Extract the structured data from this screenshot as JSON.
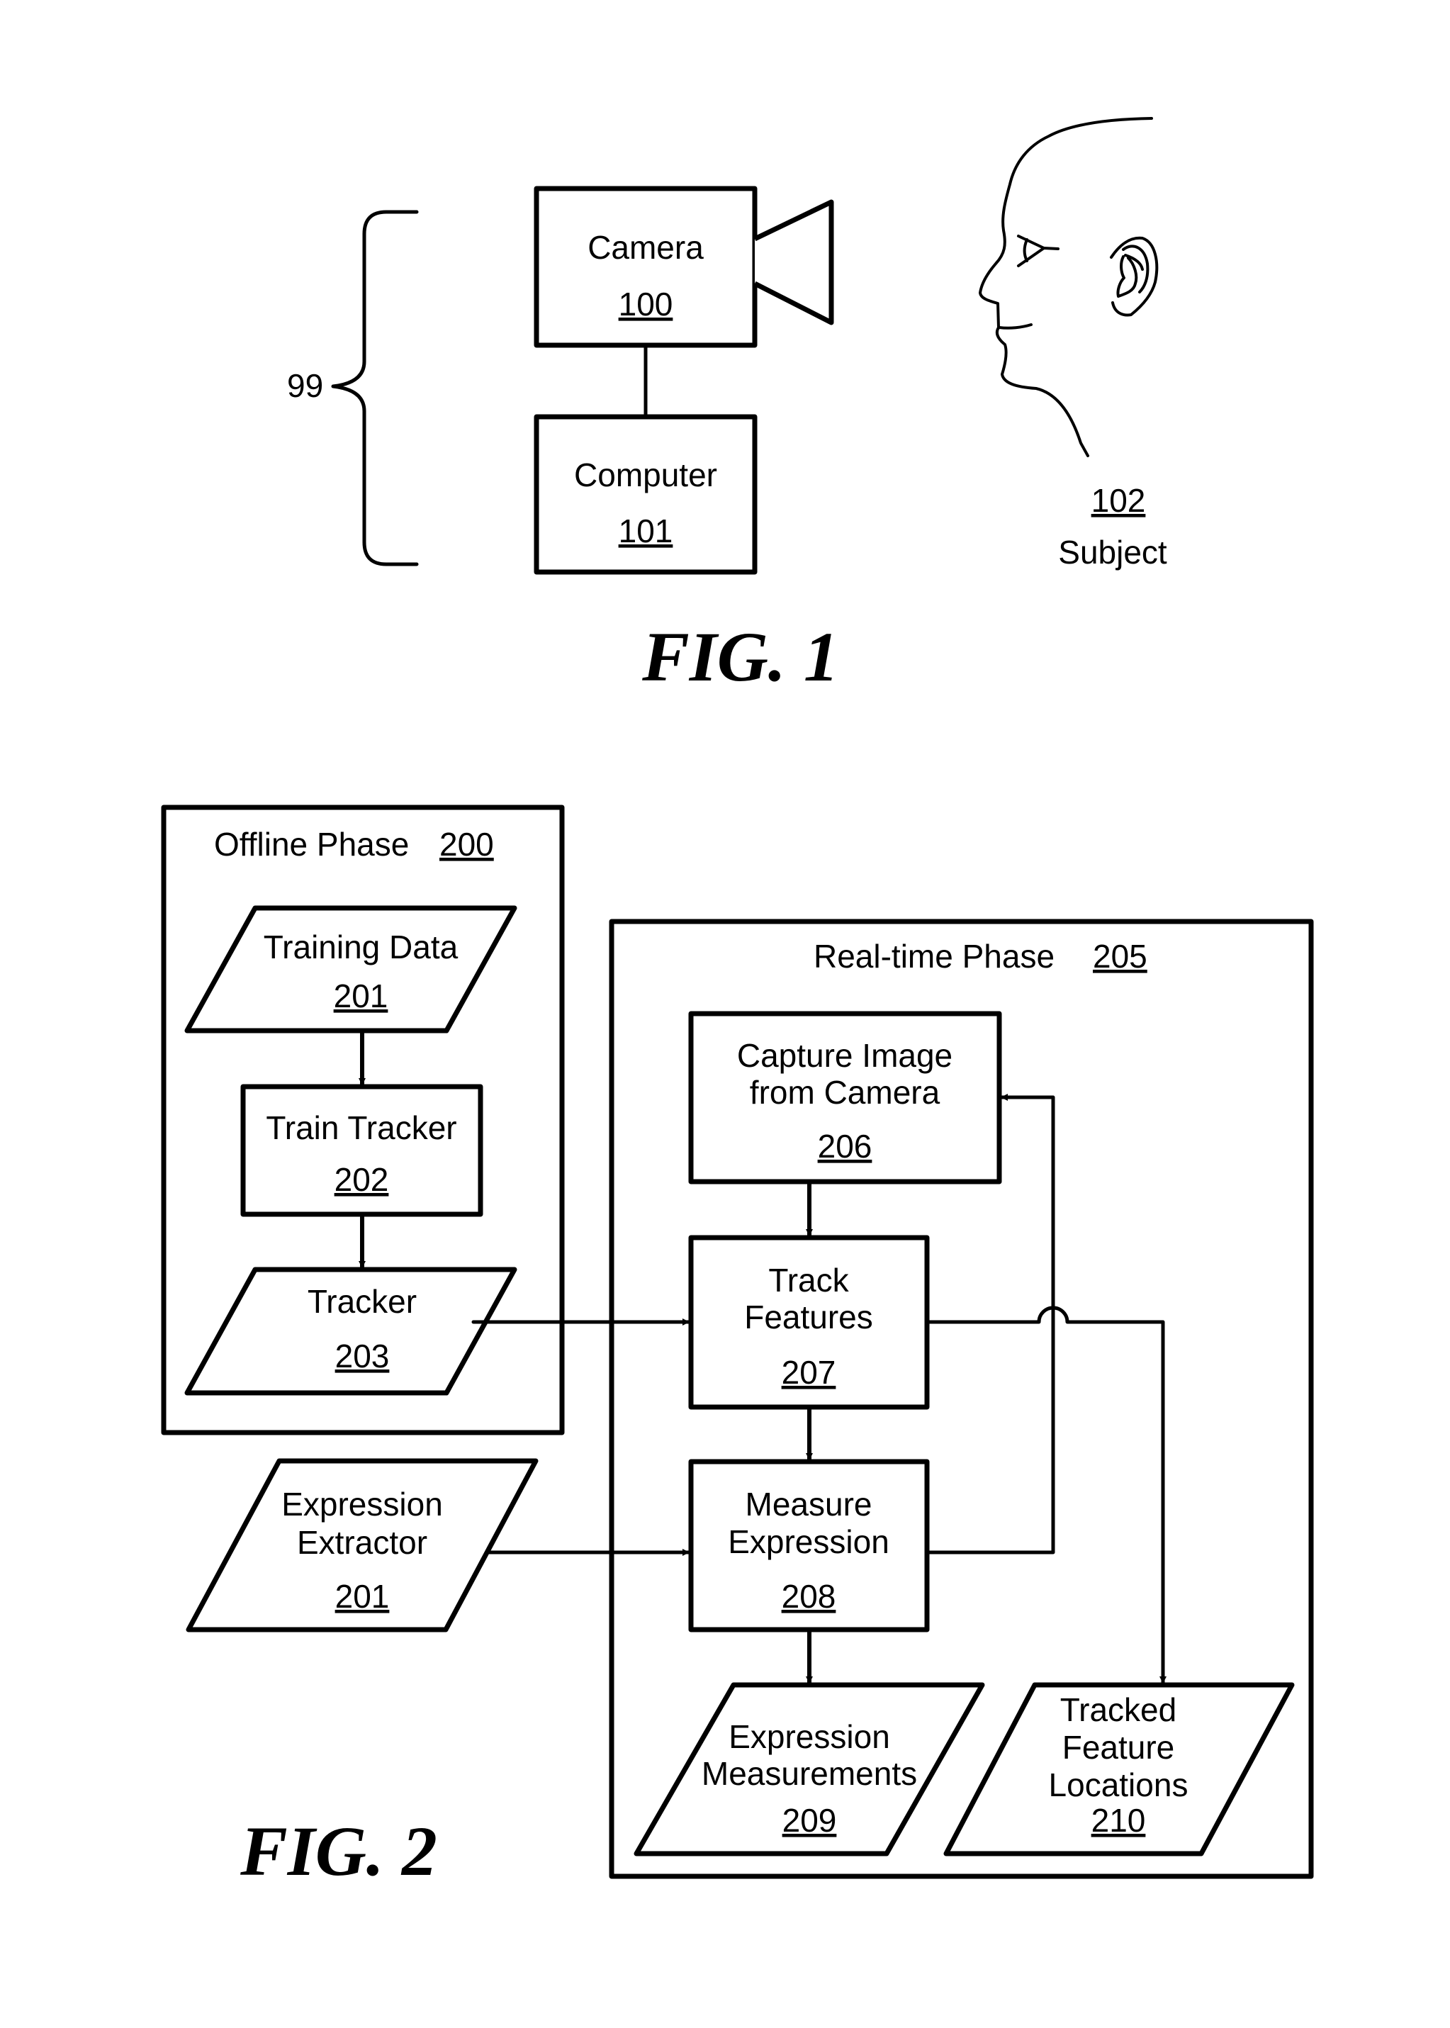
{
  "fig1": {
    "title": "FIG. 1",
    "system_label": "99",
    "camera": {
      "label": "Camera",
      "ref": "100"
    },
    "computer": {
      "label": "Computer",
      "ref": "101"
    },
    "subject": {
      "ref": "102",
      "label": "Subject"
    }
  },
  "fig2": {
    "title": "FIG. 2",
    "offline_phase": {
      "label": "Offline Phase",
      "ref": "200",
      "training_data": {
        "label": "Training Data",
        "ref": "201"
      },
      "train_tracker": {
        "label": "Train Tracker",
        "ref": "202"
      },
      "tracker": {
        "label": "Tracker",
        "ref": "203"
      }
    },
    "expression_extractor": {
      "label_line1": "Expression",
      "label_line2": "Extractor",
      "ref": "201"
    },
    "realtime_phase": {
      "label": "Real-time Phase",
      "ref": "205",
      "capture_image": {
        "label_line1": "Capture Image",
        "label_line2": "from Camera",
        "ref": "206"
      },
      "track_features": {
        "label_line1": "Track",
        "label_line2": "Features",
        "ref": "207"
      },
      "measure_expression": {
        "label_line1": "Measure",
        "label_line2": "Expression",
        "ref": "208"
      },
      "expression_measurements": {
        "label_line1": "Expression",
        "label_line2": "Measurements",
        "ref": "209"
      },
      "tracked_feature_locations": {
        "label_line1": "Tracked",
        "label_line2": "Feature",
        "label_line3": "Locations",
        "ref": "210"
      }
    }
  }
}
